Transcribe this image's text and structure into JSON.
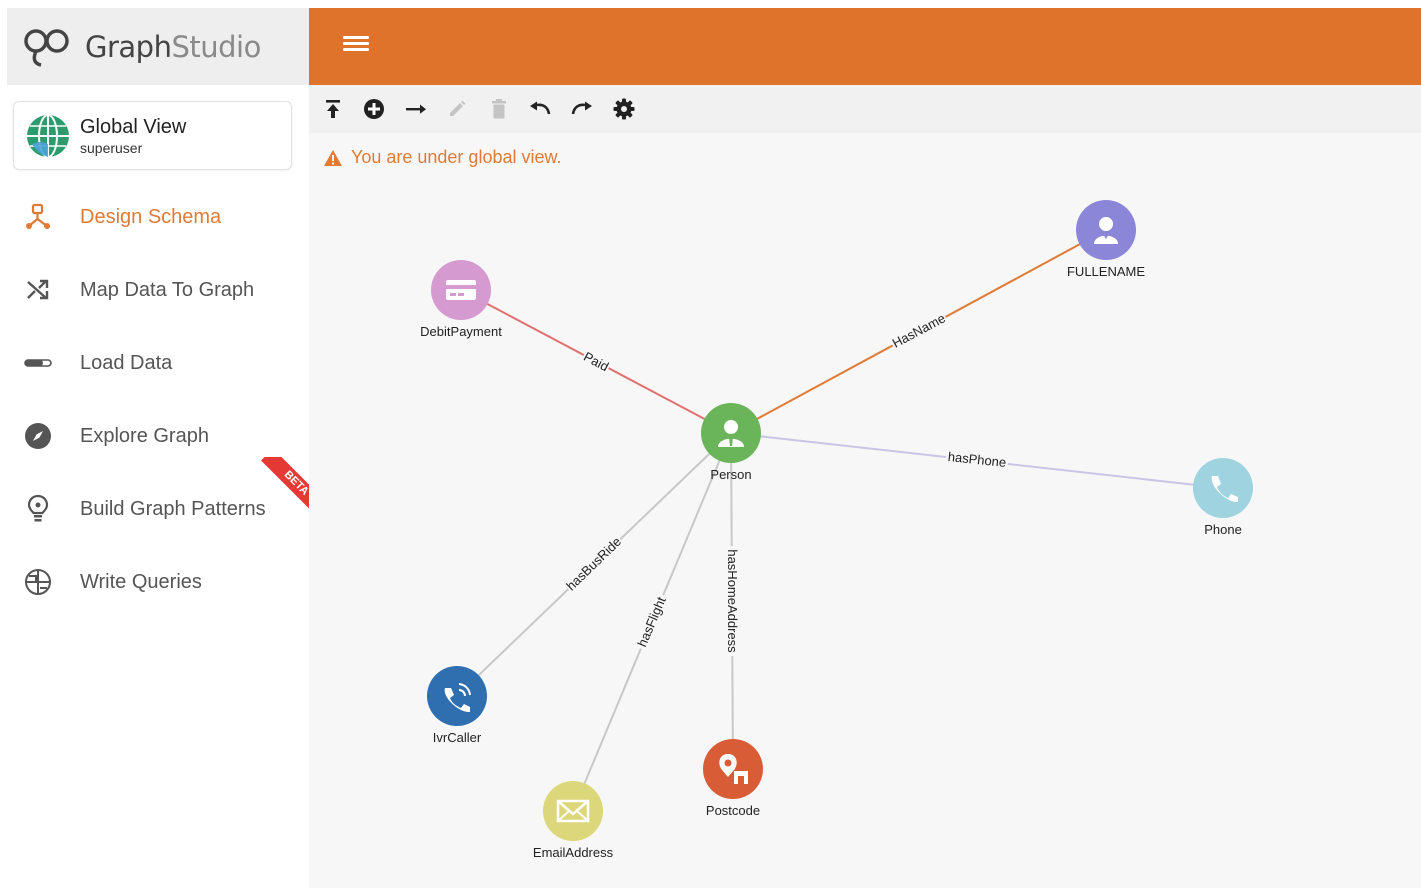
{
  "app": {
    "logo_bold": "Graph",
    "logo_light": "Studio"
  },
  "workspace": {
    "title": "Global View",
    "subtitle": "superuser"
  },
  "nav": {
    "items": [
      {
        "label": "Design Schema"
      },
      {
        "label": "Map Data To Graph"
      },
      {
        "label": "Load Data"
      },
      {
        "label": "Explore Graph"
      },
      {
        "label": "Build Graph Patterns",
        "badge": "BETA"
      },
      {
        "label": "Write Queries"
      }
    ]
  },
  "toolbar": {
    "icons": [
      "upload-icon",
      "add-vertex-icon",
      "add-edge-icon",
      "edit-icon",
      "delete-icon",
      "undo-icon",
      "redo-icon",
      "settings-icon"
    ]
  },
  "warning": {
    "text": "You are under global view."
  },
  "colors": {
    "accent": "#e0732c",
    "active": "#e07a34"
  },
  "graph": {
    "nodes": [
      {
        "id": "person",
        "label": "Person",
        "color": "#6ab45a",
        "icon": "person-icon"
      },
      {
        "id": "debit",
        "label": "DebitPayment",
        "color": "#d59bd0",
        "icon": "card-icon"
      },
      {
        "id": "fullname",
        "label": "FULLENAME",
        "color": "#8b86d8",
        "icon": "user-badge-icon"
      },
      {
        "id": "phone",
        "label": "Phone",
        "color": "#9fd3e0",
        "icon": "phone-icon"
      },
      {
        "id": "ivr",
        "label": "IvrCaller",
        "color": "#2f6fb0",
        "icon": "phone-call-icon"
      },
      {
        "id": "email",
        "label": "EmailAddress",
        "color": "#dcd77a",
        "icon": "mail-icon"
      },
      {
        "id": "postcode",
        "label": "Postcode",
        "color": "#d85c36",
        "icon": "location-icon"
      }
    ],
    "edges": [
      {
        "from": "debit",
        "to": "person",
        "label": "Paid",
        "color": "#e07070"
      },
      {
        "from": "person",
        "to": "fullname",
        "label": "HasName",
        "color": "#e07a34"
      },
      {
        "from": "person",
        "to": "phone",
        "label": "hasPhone",
        "color": "#c9c6e4"
      },
      {
        "from": "person",
        "to": "ivr",
        "label": "hasBusRide",
        "color": "#c8c8c8"
      },
      {
        "from": "person",
        "to": "email",
        "label": "hasFlight",
        "color": "#c8c8c8"
      },
      {
        "from": "person",
        "to": "postcode",
        "label": "hasHomeAddress",
        "color": "#c8c8c8"
      }
    ]
  }
}
